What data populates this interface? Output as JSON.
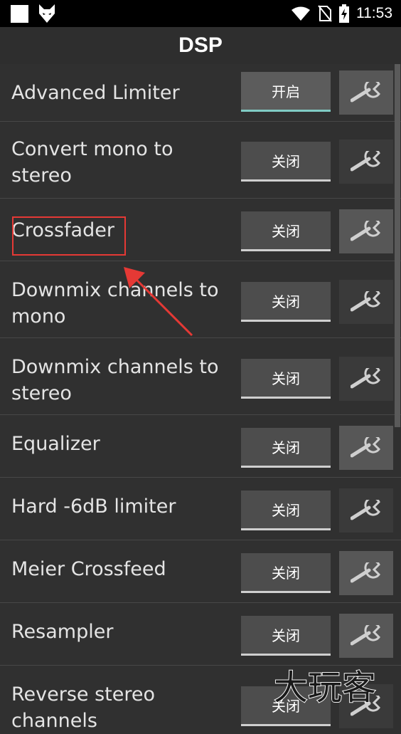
{
  "status": {
    "time": "11:53"
  },
  "title": "DSP",
  "items": [
    {
      "label": "Advanced Limiter",
      "state": "开启"
    },
    {
      "label": "Convert mono to stereo",
      "state": "关闭"
    },
    {
      "label": "Crossfader",
      "state": "关闭"
    },
    {
      "label": "Downmix channels to mono",
      "state": "关闭"
    },
    {
      "label": "Downmix channels to stereo",
      "state": "关闭"
    },
    {
      "label": "Equalizer",
      "state": "关闭"
    },
    {
      "label": "Hard -6dB limiter",
      "state": "关闭"
    },
    {
      "label": "Meier Crossfeed",
      "state": "关闭"
    },
    {
      "label": "Resampler",
      "state": "关闭"
    },
    {
      "label": "Reverse stereo channels",
      "state": "关闭"
    }
  ],
  "colors": {
    "accent_on": "#80cbc4",
    "highlight": "#e53935"
  },
  "icons": {
    "settings": "wrench-icon"
  },
  "watermark": "大玩客"
}
